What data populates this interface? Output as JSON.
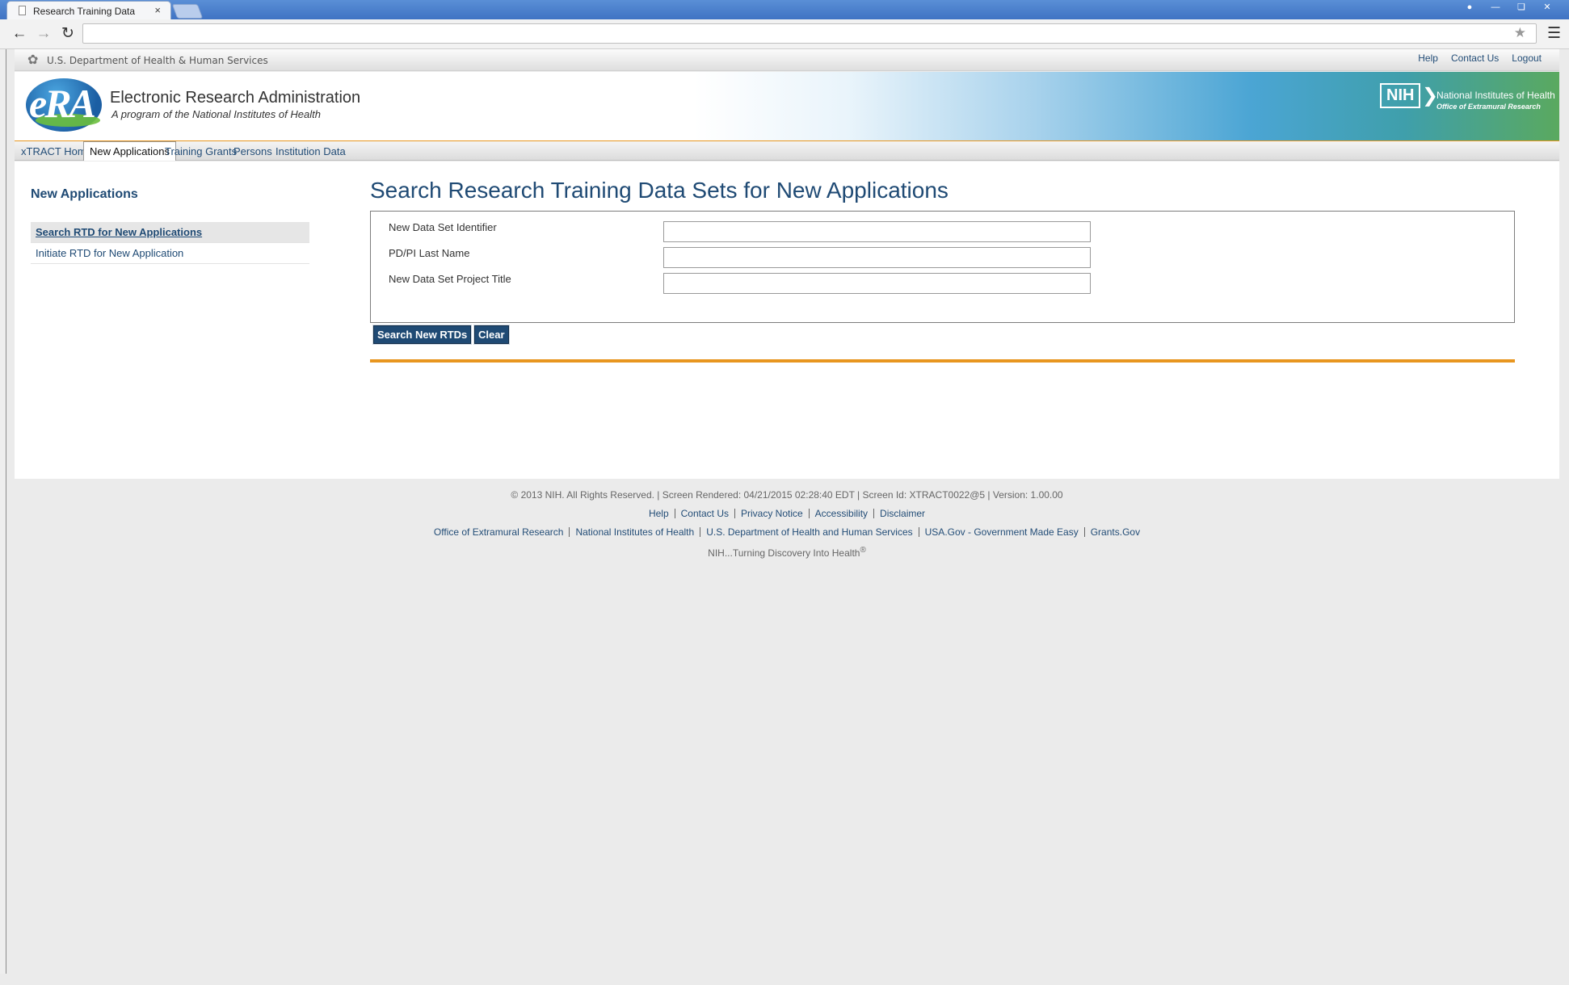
{
  "browser": {
    "tab_title": "Research Training Data",
    "tab_close": "×",
    "address": ""
  },
  "hhs": {
    "text": "U.S. Department of Health & Human Services"
  },
  "toplinks": [
    "Help",
    "Contact Us",
    "Logout"
  ],
  "banner": {
    "logo": "eRA",
    "title": "Electronic Research Administration",
    "subtitle": "A program of the National Institutes of Health",
    "nih_badge": "NIH",
    "nih_name": "National Institutes of Health",
    "nih_office": "Office of Extramural Research"
  },
  "menu": {
    "items": [
      "xTRACT Home",
      "New Applications",
      "Training Grants",
      "Persons",
      "Institution Data"
    ],
    "active": "New Applications"
  },
  "sidebar": {
    "title": "New Applications",
    "items": [
      "Search RTD for New Applications",
      "Initiate RTD for New Application"
    ]
  },
  "main": {
    "title": "Search Research Training Data Sets for New Applications",
    "fields": [
      {
        "label": "New Data Set Identifier",
        "value": ""
      },
      {
        "label": "PD/PI Last Name",
        "value": ""
      },
      {
        "label": "New Data Set Project Title",
        "value": ""
      }
    ],
    "search_button": "Search New RTDs",
    "clear_button": "Clear"
  },
  "footer": {
    "copyright": "© 2013 NIH. All Rights Reserved. | Screen Rendered: 04/21/2015 02:28:40 EDT | Screen Id: XTRACT0022@5 | Version: 1.00.00",
    "links": [
      "Help",
      "Contact Us",
      "Privacy Notice",
      "Accessibility",
      "Disclaimer"
    ],
    "links2": [
      "Office of Extramural Research",
      "National Institutes of Health",
      "U.S. Department of Health and Human Services",
      "USA.Gov - Government Made Easy",
      "Grants.Gov"
    ],
    "tagline": "NIH...Turning Discovery Into Health",
    "tagline_mark": "®"
  },
  "colors": {
    "primary": "#1f4a74",
    "accent": "#e8961f",
    "link": "#234d77"
  },
  "icons": {
    "back": "arrow-left-icon",
    "forward": "arrow-right-icon",
    "reload": "reload-icon",
    "star": "star-icon",
    "menu": "hamburger-menu-icon",
    "hhs": "hhs-eagle-icon",
    "tab": "document-icon"
  }
}
